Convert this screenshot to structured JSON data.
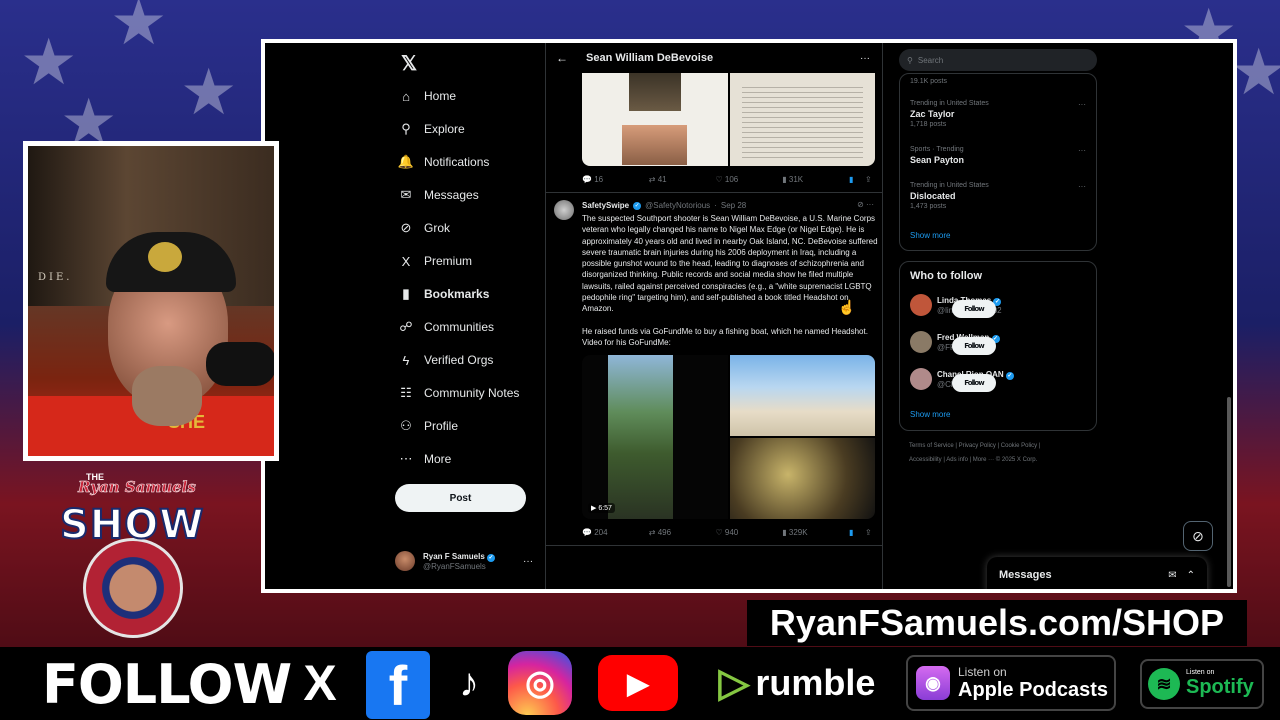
{
  "nav": {
    "items": [
      {
        "label": "Home",
        "icon": "⌂"
      },
      {
        "label": "Explore",
        "icon": "⚲"
      },
      {
        "label": "Notifications",
        "icon": "🔔"
      },
      {
        "label": "Messages",
        "icon": "✉"
      },
      {
        "label": "Grok",
        "icon": "⊘"
      },
      {
        "label": "Premium",
        "icon": "X"
      },
      {
        "label": "Bookmarks",
        "icon": "▮"
      },
      {
        "label": "Communities",
        "icon": "☍"
      },
      {
        "label": "Verified Orgs",
        "icon": "ϟ"
      },
      {
        "label": "Community Notes",
        "icon": "☷"
      },
      {
        "label": "Profile",
        "icon": "⚇"
      },
      {
        "label": "More",
        "icon": "⋯"
      }
    ],
    "post_label": "Post",
    "account": {
      "name": "Ryan F Samuels",
      "handle": "@RyanFSamuels"
    }
  },
  "timeline": {
    "title": "Sean William DeBevoise",
    "prev_actions": {
      "replies": "16",
      "reposts": "41",
      "likes": "106",
      "views": "31K"
    },
    "tweet": {
      "name": "SafetySwipe",
      "handle": "@SafetyNotorious",
      "date": "Sep 28",
      "text1": "The suspected Southport shooter is Sean William DeBevoise, a U.S. Marine Corps veteran who legally changed his name to Nigel Max Edge (or Nigel Edge). He is approximately 40 years old and lived in nearby Oak Island, NC. DeBevoise suffered severe traumatic brain injuries during his 2006 deployment in Iraq, including a possible gunshot wound to the head, leading to diagnoses of schizophrenia and disorganized thinking. Public records and social media show he filed multiple lawsuits, railed against perceived conspiracies (e.g., a \"white supremacist LGBTQ pedophile ring\" targeting him), and self-published a book titled Headshot on Amazon.",
      "text2": "He raised funds via GoFundMe to buy a fishing boat, which he named Headshot. Video for his GoFundMe:",
      "video_duration": "6:57",
      "actions": {
        "replies": "204",
        "reposts": "496",
        "likes": "940",
        "views": "329K"
      }
    }
  },
  "right": {
    "search_placeholder": "Search",
    "trends_top_posts": "19.1K posts",
    "trends": [
      {
        "context": "Trending in United States",
        "topic": "Zac Taylor",
        "posts": "1,718 posts"
      },
      {
        "context": "Sports · Trending",
        "topic": "Sean Payton",
        "posts": ""
      },
      {
        "context": "Trending in United States",
        "topic": "Dislocated",
        "posts": "1,473 posts"
      }
    ],
    "show_more": "Show more",
    "who_to_follow": "Who to follow",
    "follow_label": "Follow",
    "suggestions": [
      {
        "name": "Linda Thomas",
        "handle": "@lindathomas102",
        "color": "#c0563a"
      },
      {
        "name": "Fred Wellman",
        "handle": "@FPWellman",
        "color": "#8a7a66"
      },
      {
        "name": "Chanel Rion OAN",
        "handle": "@ChanelRion",
        "color": "#b08a8a"
      }
    ],
    "footer_line1": "Terms of Service  |  Privacy Policy  |  Cookie Policy  |",
    "footer_line2": "Accessibility  |  Ads info  |  More ···  © 2025 X Corp.",
    "messages_label": "Messages"
  },
  "overlay": {
    "webcam_sign": "DIE.",
    "shirt_text": "SHE",
    "show_the": "THE",
    "show_script": "Ryan Samuels",
    "show_word": "SHOW",
    "shop_url": "RyanFSamuels.com/SHOP",
    "follow": "FOLLOW",
    "x": "X",
    "facebook": "f",
    "tiktok": "♪",
    "instagram": "◎",
    "youtube": "▶",
    "rumble": "rumble",
    "apple_small": "Listen on",
    "apple_big": "Apple Podcasts",
    "spotify_small": "Listen on",
    "spotify_big": "Spotify"
  }
}
